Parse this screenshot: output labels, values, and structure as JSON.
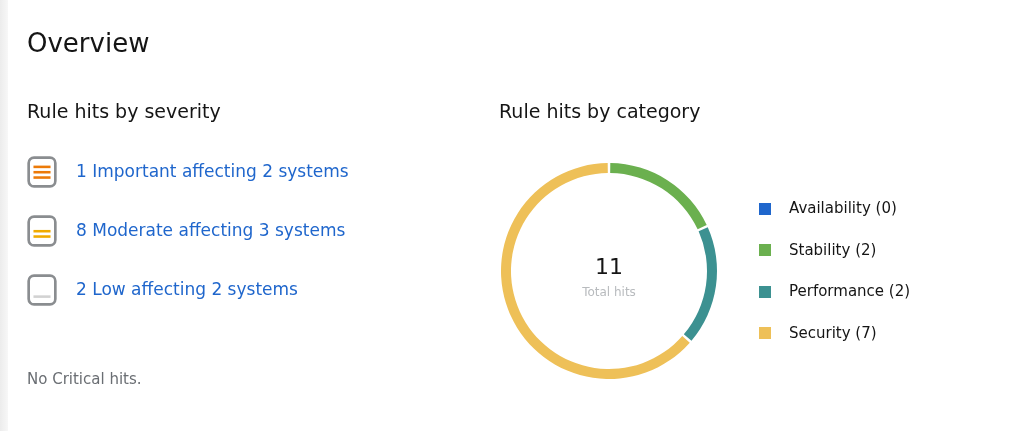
{
  "title": "Overview",
  "severity": {
    "heading": "Rule hits by severity",
    "items": [
      {
        "kind": "important",
        "text": "1 Important affecting 2 systems"
      },
      {
        "kind": "moderate",
        "text": "8 Moderate affecting 3 systems"
      },
      {
        "kind": "low",
        "text": "2 Low affecting 2 systems"
      }
    ],
    "note": "No Critical hits."
  },
  "category": {
    "heading": "Rule hits by category",
    "total": "11",
    "total_label": "Total hits",
    "chart_data": {
      "type": "donut",
      "categories": [
        "Availability (0)",
        "Stability (2)",
        "Performance (2)",
        "Security (7)"
      ],
      "series": [
        {
          "values": [
            0,
            2,
            2,
            7
          ]
        }
      ],
      "legend": "right",
      "colors": [
        "#1f66cc",
        "#6bb04f",
        "#3c9191",
        "#eec058"
      ]
    }
  }
}
